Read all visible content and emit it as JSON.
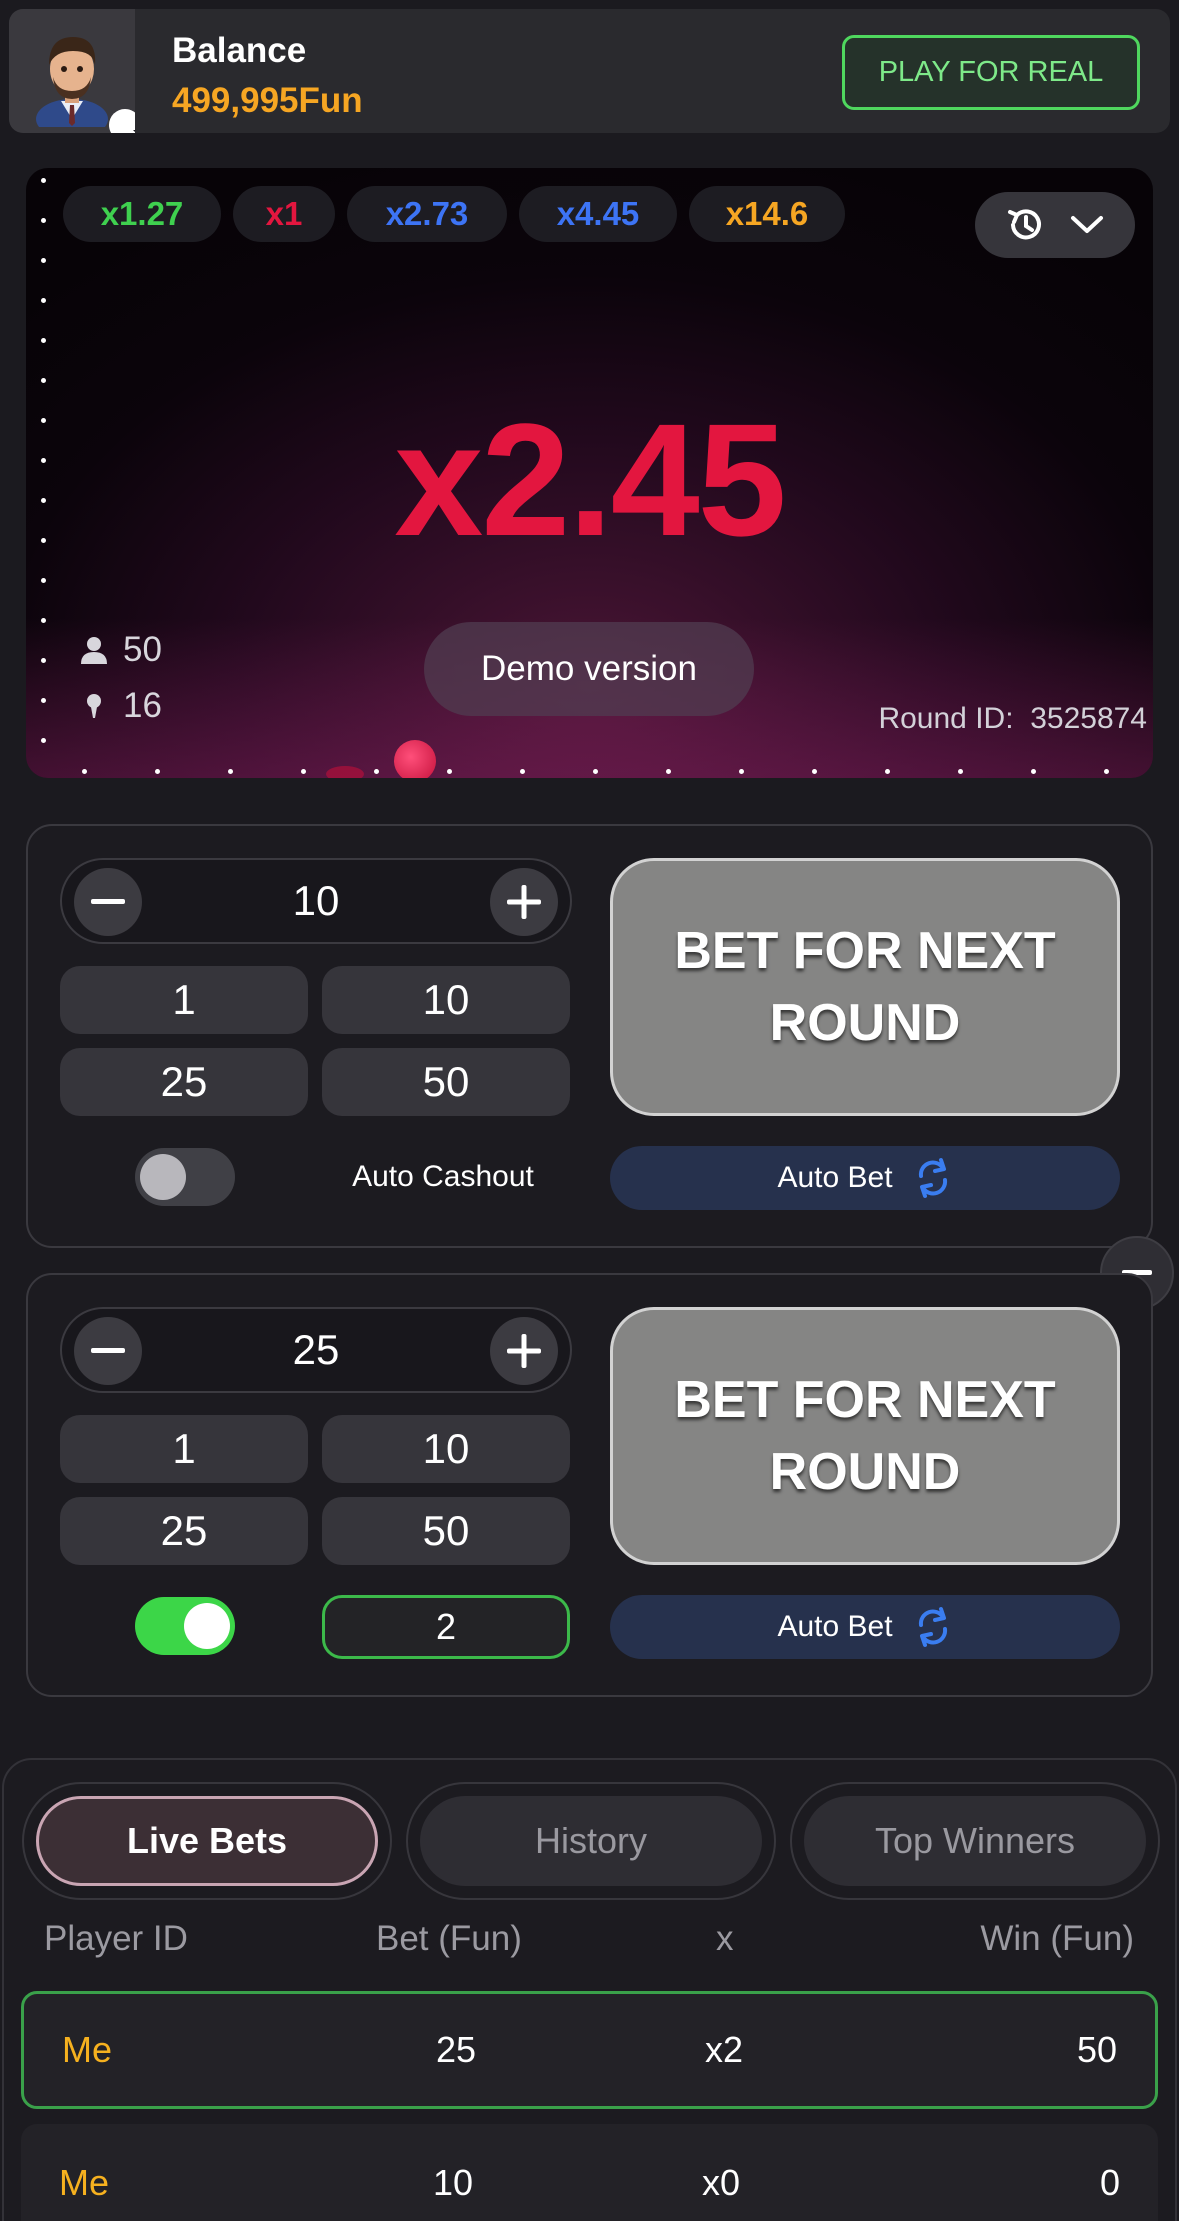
{
  "header": {
    "balance_label": "Balance",
    "balance_value": "499,995Fun",
    "play_real_label": "PLAY FOR REAL"
  },
  "game": {
    "recent_multipliers": [
      {
        "label": "x1.27",
        "color": "#3fd04f"
      },
      {
        "label": "x1",
        "color": "#e3163f"
      },
      {
        "label": "x2.73",
        "color": "#3d74f5"
      },
      {
        "label": "x4.45",
        "color": "#3d74f5"
      },
      {
        "label": "x14.6",
        "color": "#f6a623"
      }
    ],
    "current_multiplier": "x2.45",
    "demo_label": "Demo version",
    "players_count": "50",
    "bets_count": "16",
    "round_id_label": "Round ID:",
    "round_id_value": "3525874"
  },
  "panels": [
    {
      "amount": "10",
      "quick": [
        "1",
        "10",
        "25",
        "50"
      ],
      "auto_cashout_enabled": false,
      "auto_cashout_label": "Auto Cashout",
      "bet_label": "BET FOR NEXT ROUND",
      "auto_bet_label": "Auto Bet"
    },
    {
      "amount": "25",
      "quick": [
        "1",
        "10",
        "25",
        "50"
      ],
      "auto_cashout_enabled": true,
      "auto_cashout_value": "2",
      "bet_label": "BET FOR NEXT ROUND",
      "auto_bet_label": "Auto Bet"
    }
  ],
  "bets_list": {
    "tabs": [
      "Live Bets",
      "History",
      "Top Winners"
    ],
    "active_tab": "Live Bets",
    "columns": [
      "Player ID",
      "Bet (Fun)",
      "x",
      "Win (Fun)"
    ],
    "rows": [
      {
        "player": "Me",
        "bet": "25",
        "x": "x2",
        "win": "50",
        "highlighted": true
      },
      {
        "player": "Me",
        "bet": "10",
        "x": "x0",
        "win": "0",
        "highlighted": false
      }
    ]
  },
  "colors": {
    "accent_green": "#3cd648",
    "balance_orange": "#f6a623",
    "multiplier_red": "#e3163f",
    "auto_bet_blue": "#26314d"
  }
}
